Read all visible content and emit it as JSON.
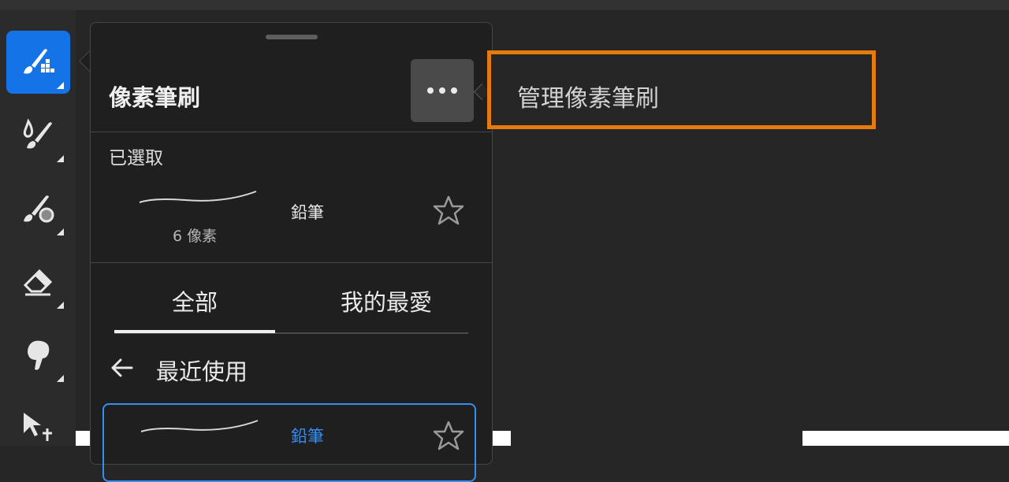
{
  "toolbar": {
    "tools": [
      {
        "icon": "pixel-brush-icon",
        "active": true
      },
      {
        "icon": "paint-brush-icon",
        "active": false
      },
      {
        "icon": "mixer-brush-icon",
        "active": false
      },
      {
        "icon": "eraser-icon",
        "active": false
      },
      {
        "icon": "smudge-icon",
        "active": false
      },
      {
        "icon": "move-icon",
        "active": false
      }
    ]
  },
  "panel": {
    "title": "像素筆刷",
    "more_icon": "more-icon",
    "selected_label": "已選取",
    "selected_brush": {
      "name": "鉛筆",
      "size": "6 像素"
    },
    "tabs": [
      {
        "label": "全部",
        "active": true
      },
      {
        "label": "我的最愛",
        "active": false
      }
    ],
    "section_heading": "最近使用",
    "recent_brushes": [
      {
        "name": "鉛筆",
        "selected": true
      }
    ]
  },
  "menu": {
    "items": [
      {
        "label": "管理像素筆刷"
      }
    ]
  },
  "colors": {
    "accent": "#1473e6",
    "highlight": "#e47b0c",
    "selected_text": "#378ef0"
  }
}
